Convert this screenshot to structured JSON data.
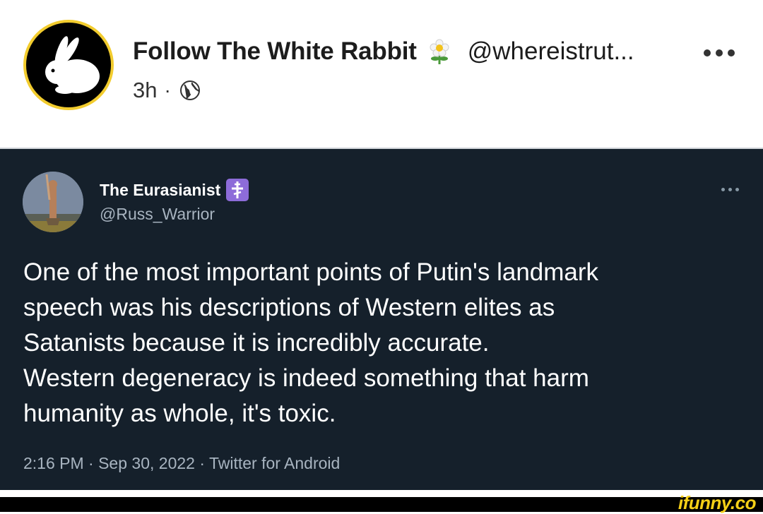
{
  "post": {
    "author_name": "Follow The White Rabbit",
    "author_emoji": "flower-icon",
    "author_handle": "@whereistrut...",
    "time": "3h",
    "separator": "·",
    "visibility_icon": "globe-icon",
    "more_icon": "more-options-icon"
  },
  "tweet": {
    "name": "The Eurasianist",
    "badge_icon": "orthodox-cross-icon",
    "handle": "@Russ_Warrior",
    "body": "One of the most important points of Putin's landmark\nspeech was his descriptions of Western elites as\nSatanists because it is incredibly accurate.\nWestern degeneracy is indeed something that harm\nhumanity as whole, it's toxic.",
    "meta": "2:16 PM · Sep 30, 2022 · Twitter for Android"
  },
  "watermark": "ifunny.co",
  "colors": {
    "avatar_ring": "#f2cc2e",
    "tweet_background": "#15202b",
    "badge": "#8d6cd9",
    "watermark": "#f5cf17"
  }
}
